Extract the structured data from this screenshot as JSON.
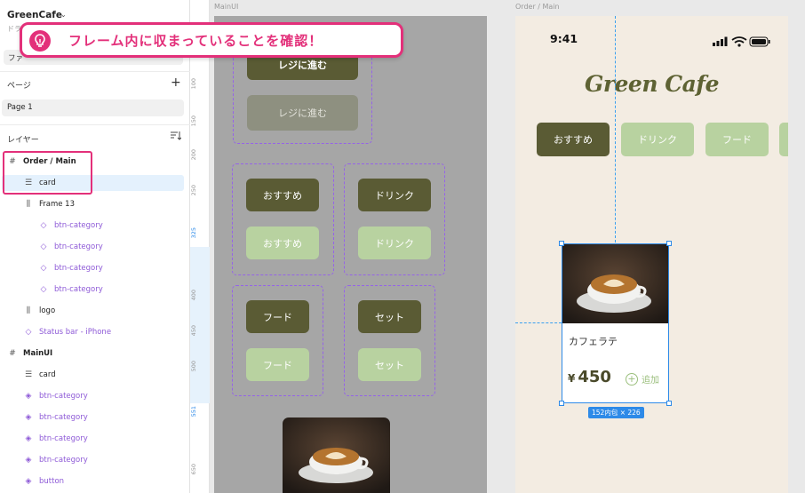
{
  "file": {
    "name": "GreenCafe",
    "caret": "⌄",
    "subtitle": "ドラ"
  },
  "tabs": {
    "label": "ファ"
  },
  "pages": {
    "heading": "ページ",
    "add": "+",
    "items": [
      "Page 1"
    ]
  },
  "layers": {
    "heading": "レイヤー",
    "sort_icon": "sort-icon",
    "items": [
      {
        "label": "Order / Main",
        "icon": "#",
        "type": "frame"
      },
      {
        "label": "card",
        "icon": "☰",
        "type": "component-instance"
      },
      {
        "label": "Frame 13",
        "icon": "⫼",
        "type": "auto-layout"
      },
      {
        "label": "btn-category",
        "icon": "◇",
        "type": "instance"
      },
      {
        "label": "btn-category",
        "icon": "◇",
        "type": "instance"
      },
      {
        "label": "btn-category",
        "icon": "◇",
        "type": "instance"
      },
      {
        "label": "btn-category",
        "icon": "◇",
        "type": "instance"
      },
      {
        "label": "logo",
        "icon": "⫼",
        "type": "auto-layout"
      },
      {
        "label": "Status bar - iPhone",
        "icon": "◇",
        "type": "instance"
      },
      {
        "label": "MainUI",
        "icon": "#",
        "type": "frame"
      },
      {
        "label": "card",
        "icon": "☰",
        "type": "component"
      },
      {
        "label": "btn-category",
        "icon": "◈",
        "type": "component"
      },
      {
        "label": "btn-category",
        "icon": "◈",
        "type": "component"
      },
      {
        "label": "btn-category",
        "icon": "◈",
        "type": "component"
      },
      {
        "label": "btn-category",
        "icon": "◈",
        "type": "component"
      },
      {
        "label": "button",
        "icon": "◈",
        "type": "component"
      }
    ]
  },
  "ruler": {
    "marks": [
      "100",
      "150",
      "200",
      "250",
      "325",
      "400",
      "450",
      "500",
      "551",
      "650"
    ]
  },
  "tip": {
    "text": "フレーム内に収まっていることを確認！"
  },
  "canvas": {
    "mainui_label": "MainUI",
    "order_label": "Order / Main",
    "mainui": {
      "checkout_active": "レジに進む",
      "checkout_disabled": "レジに進む",
      "cat_recommend_dark": "おすすめ",
      "cat_recommend_light": "おすすめ",
      "cat_drink_dark": "ドリンク",
      "cat_drink_light": "ドリンク",
      "cat_food_dark": "フード",
      "cat_food_light": "フード",
      "cat_set_dark": "セット",
      "cat_set_light": "セット"
    },
    "order": {
      "time": "9:41",
      "logo": "Green Cafe",
      "categories": [
        "おすすめ",
        "ドリンク",
        "フード"
      ],
      "card": {
        "name": "カフェラテ",
        "currency": "¥",
        "price": "450",
        "add_label": "追加"
      },
      "size_badge": "152内包 × 226"
    }
  },
  "colors": {
    "accent": "#e3307a",
    "selection": "#2d8ae8",
    "olive": "#5a5b34",
    "sage": "#b8d2a0",
    "cream": "#f3ece2",
    "component": "#8e5ad7"
  }
}
